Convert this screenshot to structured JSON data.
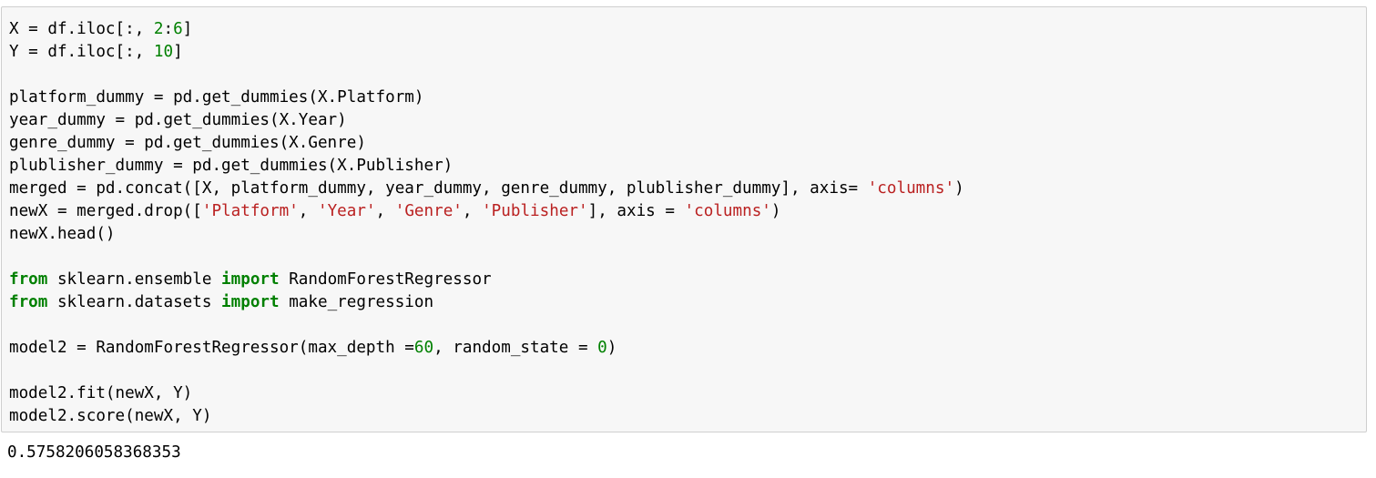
{
  "code_cell": {
    "lines": [
      [
        {
          "t": "plain",
          "v": "X = df.iloc[:, "
        },
        {
          "t": "num",
          "v": "2"
        },
        {
          "t": "plain",
          "v": ":"
        },
        {
          "t": "num",
          "v": "6"
        },
        {
          "t": "plain",
          "v": "]"
        }
      ],
      [
        {
          "t": "plain",
          "v": "Y = df.iloc[:, "
        },
        {
          "t": "num",
          "v": "10"
        },
        {
          "t": "plain",
          "v": "]"
        }
      ],
      [],
      [
        {
          "t": "plain",
          "v": "platform_dummy = pd.get_dummies(X.Platform)"
        }
      ],
      [
        {
          "t": "plain",
          "v": "year_dummy = pd.get_dummies(X.Year)"
        }
      ],
      [
        {
          "t": "plain",
          "v": "genre_dummy = pd.get_dummies(X.Genre)"
        }
      ],
      [
        {
          "t": "plain",
          "v": "plublisher_dummy = pd.get_dummies(X.Publisher)"
        }
      ],
      [
        {
          "t": "plain",
          "v": "merged = pd.concat([X, platform_dummy, year_dummy, genre_dummy, plublisher_dummy], axis= "
        },
        {
          "t": "str",
          "v": "'columns'"
        },
        {
          "t": "plain",
          "v": ")"
        }
      ],
      [
        {
          "t": "plain",
          "v": "newX = merged.drop(["
        },
        {
          "t": "str",
          "v": "'Platform'"
        },
        {
          "t": "plain",
          "v": ", "
        },
        {
          "t": "str",
          "v": "'Year'"
        },
        {
          "t": "plain",
          "v": ", "
        },
        {
          "t": "str",
          "v": "'Genre'"
        },
        {
          "t": "plain",
          "v": ", "
        },
        {
          "t": "str",
          "v": "'Publisher'"
        },
        {
          "t": "plain",
          "v": "], axis = "
        },
        {
          "t": "str",
          "v": "'columns'"
        },
        {
          "t": "plain",
          "v": ")"
        }
      ],
      [
        {
          "t": "plain",
          "v": "newX.head()"
        }
      ],
      [],
      [
        {
          "t": "kw",
          "v": "from"
        },
        {
          "t": "plain",
          "v": " sklearn.ensemble "
        },
        {
          "t": "kw",
          "v": "import"
        },
        {
          "t": "plain",
          "v": " RandomForestRegressor"
        }
      ],
      [
        {
          "t": "kw",
          "v": "from"
        },
        {
          "t": "plain",
          "v": " sklearn.datasets "
        },
        {
          "t": "kw",
          "v": "import"
        },
        {
          "t": "plain",
          "v": " make_regression"
        }
      ],
      [],
      [
        {
          "t": "plain",
          "v": "model2 = RandomForestRegressor(max_depth ="
        },
        {
          "t": "num",
          "v": "60"
        },
        {
          "t": "plain",
          "v": ", random_state = "
        },
        {
          "t": "num",
          "v": "0"
        },
        {
          "t": "plain",
          "v": ")"
        }
      ],
      [],
      [
        {
          "t": "plain",
          "v": "model2.fit(newX, Y)"
        }
      ],
      [
        {
          "t": "plain",
          "v": "model2.score(newX, Y)"
        }
      ]
    ]
  },
  "output_cell": {
    "text": "0.5758206058368353"
  },
  "colors": {
    "keyword": "#008000",
    "number": "#008000",
    "string": "#ba2121",
    "cell_background": "#f7f7f7",
    "cell_border": "#cfcfcf"
  }
}
